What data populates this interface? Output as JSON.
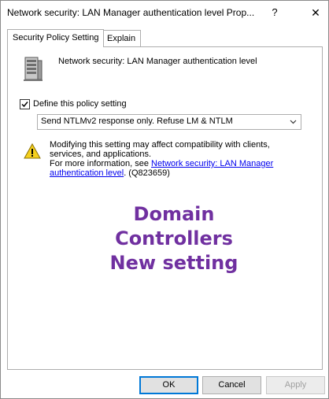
{
  "window": {
    "title": "Network security: LAN Manager authentication level Prop...",
    "help_glyph": "?",
    "close_glyph": "✕"
  },
  "tabs": [
    {
      "label": "Security Policy Setting",
      "active": true
    },
    {
      "label": "Explain",
      "active": false
    }
  ],
  "policy": {
    "icon": "server-icon",
    "name": "Network security: LAN Manager authentication level"
  },
  "define_setting": {
    "label": "Define this policy setting",
    "checked": true
  },
  "level_select": {
    "value": "Send NTLMv2 response only. Refuse LM & NTLM"
  },
  "warning": {
    "icon": "warning-icon",
    "text_line1": "Modifying this setting may affect compatibility with clients, services, and applications.",
    "text_pre_link": "For more information, see ",
    "link_text": "Network security: LAN Manager authentication level",
    "text_post_link": ". (Q823659)"
  },
  "overlay": {
    "line1": "Domain",
    "line2": "Controllers",
    "line3": "New setting",
    "color": "#7030a0"
  },
  "buttons": {
    "ok": "OK",
    "cancel": "Cancel",
    "apply": "Apply"
  }
}
